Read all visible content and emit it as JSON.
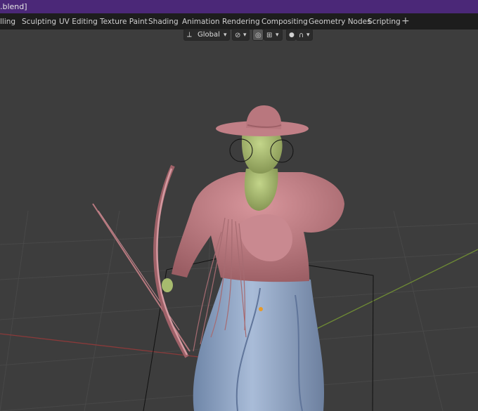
{
  "window": {
    "title": ".blend]"
  },
  "workspace_tabs": [
    "lling",
    "Sculpting",
    "UV Editing",
    "Texture Paint",
    "Shading",
    "Animation",
    "Rendering",
    "Compositing",
    "Geometry Nodes",
    "Scripting"
  ],
  "header": {
    "add_tab": "+",
    "transform_orientation": "Global"
  },
  "colors": {
    "title_bar": "#4b2878",
    "tab_bar": "#1d1d1d",
    "viewport_bg": "#3d3d3d",
    "x_axis": "#8a3a3a",
    "y_axis": "#6e8a35",
    "skin": "#a7bb6e",
    "shirt": "#c17f86",
    "pants": "#8ea3c4",
    "bow": "#c98a92"
  },
  "icons": [
    "transform-orientation-icon",
    "chevron-down-icon",
    "link-icon",
    "snap-icon",
    "snap-increment-icon",
    "proportional-edit-icon",
    "falloff-icon"
  ]
}
